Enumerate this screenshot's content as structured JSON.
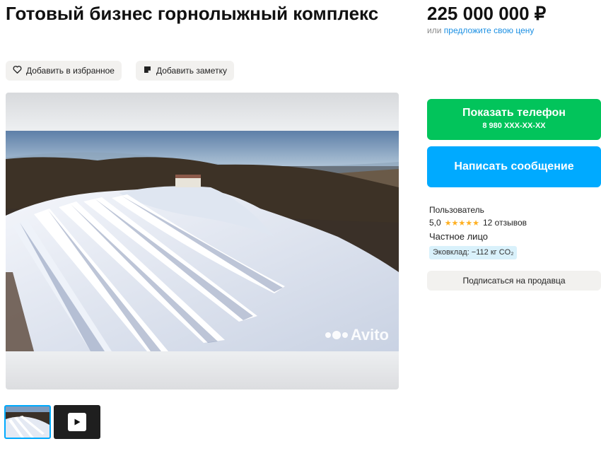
{
  "listing": {
    "title": "Готовый бизнес горнолыжный комплекс",
    "price": "225 000 000 ₽",
    "offer_prefix": "или",
    "offer_link": "предложите свою цену"
  },
  "actions": {
    "favorite_label": "Добавить в избранное",
    "note_label": "Добавить заметку"
  },
  "gallery": {
    "watermark": "Avito",
    "thumbnails": [
      {
        "kind": "photo",
        "selected": true
      },
      {
        "kind": "video",
        "icon": "play-icon"
      }
    ]
  },
  "contact": {
    "phone_label": "Показать телефон",
    "phone_number": "8 980 XXX-XX-XX",
    "message_label": "Написать сообщение",
    "phone_color": "#02c45b",
    "message_color": "#00aaff"
  },
  "seller": {
    "name": "Пользователь",
    "rating": "5,0",
    "stars": "★★★★★",
    "reviews": "12 отзывов",
    "type": "Частное лицо",
    "eco": "Эковклад: −112 кг CO₂",
    "subscribe_label": "Подписаться на продавца"
  }
}
